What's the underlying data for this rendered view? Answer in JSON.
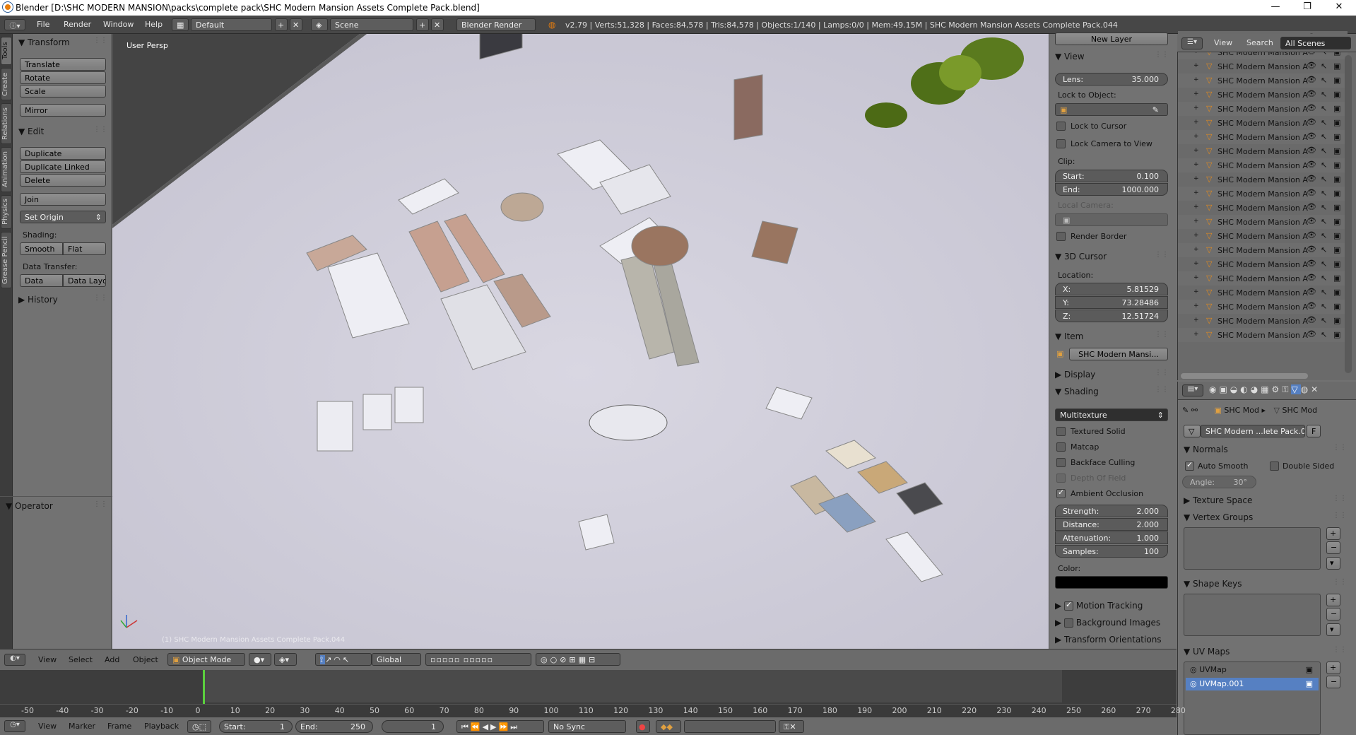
{
  "window": {
    "title": "Blender [D:\\SHC MODERN MANSION\\packs\\complete pack\\SHC Modern Mansion Assets Complete Pack.blend]"
  },
  "infobar": {
    "menus": [
      "File",
      "Render",
      "Window",
      "Help"
    ],
    "layout": "Default",
    "scene": "Scene",
    "engine": "Blender Render",
    "stats": "v2.79 | Verts:51,328 | Faces:84,578 | Tris:84,578 | Objects:1/140 | Lamps:0/0 | Mem:49.15M | SHC Modern Mansion Assets Complete Pack.044"
  },
  "lefttabs": [
    "Tools",
    "Create",
    "Relations",
    "Animation",
    "Physics",
    "Grease Pencil"
  ],
  "toolshelf": {
    "transform": {
      "title": "Transform",
      "buttons": [
        "Translate",
        "Rotate",
        "Scale",
        "Mirror"
      ]
    },
    "edit": {
      "title": "Edit",
      "buttons": [
        "Duplicate",
        "Duplicate Linked",
        "Delete",
        "Join",
        "Set Origin"
      ]
    },
    "shading": {
      "label": "Shading:",
      "smooth": "Smooth",
      "flat": "Flat"
    },
    "transfer": {
      "label": "Data Transfer:",
      "data": "Data",
      "layout": "Data Layo"
    },
    "history": "History",
    "operator": "Operator"
  },
  "viewport": {
    "label": "User Persp",
    "object_label": "(1) SHC Modern Mansion Assets Complete Pack.044"
  },
  "viewhdr": {
    "menus": [
      "View",
      "Select",
      "Add",
      "Object"
    ],
    "mode": "Object Mode",
    "orientation": "Global"
  },
  "timeline": {
    "ticks": [
      "-50",
      "-40",
      "-30",
      "-20",
      "-10",
      "0",
      "10",
      "20",
      "30",
      "40",
      "50",
      "60",
      "70",
      "80",
      "90",
      "100",
      "110",
      "120",
      "130",
      "140",
      "150",
      "160",
      "170",
      "180",
      "190",
      "200",
      "210",
      "220",
      "230",
      "240",
      "250",
      "260",
      "270",
      "280"
    ],
    "menus": [
      "View",
      "Marker",
      "Frame",
      "Playback"
    ],
    "start": "Start:",
    "start_val": "1",
    "end": "End:",
    "end_val": "250",
    "frame": "1",
    "sync": "No Sync"
  },
  "npanel": {
    "new_layer": "New Layer",
    "view": {
      "title": "View",
      "lens": "Lens:",
      "lens_val": "35.000",
      "lock_obj": "Lock to Object:",
      "lock_cursor": "Lock to Cursor",
      "lock_cam": "Lock Camera to View",
      "clip": "Clip:",
      "start": "Start:",
      "start_val": "0.100",
      "end": "End:",
      "end_val": "1000.000",
      "local_cam": "Local Camera:",
      "render_border": "Render Border"
    },
    "cursor": {
      "title": "3D Cursor",
      "location": "Location:",
      "x": "X:",
      "x_val": "5.81529",
      "y": "Y:",
      "y_val": "73.28486",
      "z": "Z:",
      "z_val": "12.51724"
    },
    "item": {
      "title": "Item",
      "name": "SHC Modern Mansi..."
    },
    "display": "Display",
    "shading": {
      "title": "Shading",
      "mode": "Multitexture",
      "opts": [
        "Textured Solid",
        "Matcap",
        "Backface Culling",
        "Depth Of Field",
        "Ambient Occlusion"
      ],
      "strength": "Strength:",
      "strength_val": "2.000",
      "distance": "Distance:",
      "distance_val": "2.000",
      "atten": "Attenuation:",
      "atten_val": "1.000",
      "samples": "Samples:",
      "samples_val": "100",
      "color": "Color:"
    },
    "motion": "Motion Tracking",
    "bg": "Background Images",
    "torient": "Transform Orientations"
  },
  "outliner": {
    "view": "View",
    "search": "Search",
    "scenes": "All Scenes",
    "item": "SHC Modern Mansion A",
    "count": 22
  },
  "props": {
    "crumb1": "SHC Mod",
    "crumb2": "SHC Mod",
    "mesh": "SHC Modern ...lete Pack.044",
    "fake": "F",
    "normals": "Normals",
    "auto_smooth": "Auto Smooth",
    "double_sided": "Double Sided",
    "angle": "Angle:",
    "angle_val": "30°",
    "texspace": "Texture Space",
    "vgroups": "Vertex Groups",
    "shapekeys": "Shape Keys",
    "uvmaps": "UV Maps",
    "uv1": "UVMap",
    "uv2": "UVMap.001"
  },
  "colors": {
    "viewport": "#cbc9d6",
    "panel": "#727272",
    "header": "#6b6b6b",
    "selection": "#5680c2"
  }
}
